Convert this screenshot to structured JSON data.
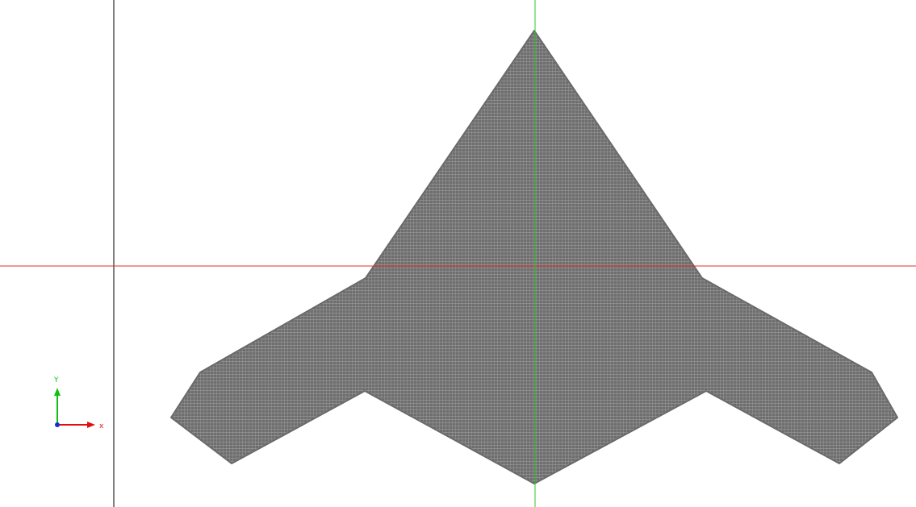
{
  "viewport": {
    "background": "#ffffff",
    "mesh_color": "#6e6e6e",
    "mesh_grid_color": "#a8a8a8",
    "horizontal_axis_color": "#e03030",
    "vertical_axis_color": "#2ec82e",
    "frame_line_color": "#000000"
  },
  "axis_triad": {
    "x_label": "x",
    "y_label": "Y",
    "x_color": "#e01010",
    "y_color": "#10c010",
    "origin_color": "#1030d0",
    "x_icon": "x-axis-arrow-icon",
    "y_icon": "y-axis-arrow-icon"
  }
}
